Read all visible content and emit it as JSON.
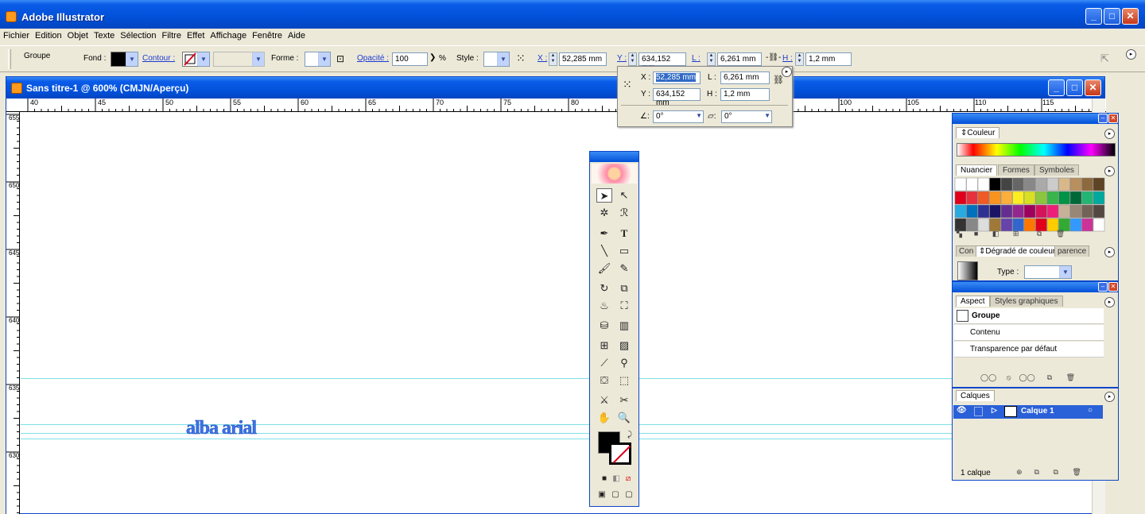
{
  "app": {
    "title": "Adobe Illustrator"
  },
  "menu": [
    "Fichier",
    "Edition",
    "Objet",
    "Texte",
    "Sélection",
    "Filtre",
    "Effet",
    "Affichage",
    "Fenêtre",
    "Aide"
  ],
  "control": {
    "selection": "Groupe",
    "fill_label": "Fond :",
    "stroke_label": "Contour :",
    "shape_label": "Forme :",
    "opacity_label": "Opacité :",
    "opacity_value": "100",
    "opacity_unit": "%",
    "style_label": "Style :",
    "x_label": "X :",
    "x_value": "52,285 mm",
    "y_label": "Y :",
    "y_value": "634,152 mm",
    "l_label": "L :",
    "l_value": "6,261 mm",
    "h_label": "H :",
    "h_value": "1,2 mm"
  },
  "document": {
    "title": "Sans titre-1 @ 600% (CMJN/Aperçu)",
    "hruler_labels": [
      "40",
      "45",
      "50",
      "55",
      "60",
      "65",
      "70",
      "75",
      "80",
      "100",
      "105",
      "110",
      "115"
    ],
    "vruler_labels": [
      "655",
      "650",
      "645",
      "640",
      "635",
      "630"
    ],
    "canvas_text": "alba arial"
  },
  "popup": {
    "x_label": "X :",
    "x_value": "52,285 mm",
    "y_label": "Y :",
    "y_value": "634,152 mm",
    "l_label": "L :",
    "l_value": "6,261 mm",
    "h_label": "H :",
    "h_value": "1,2 mm",
    "angle1": "0°",
    "angle2": "0°"
  },
  "panels": {
    "couleur": {
      "tab": "Couleur"
    },
    "swatches": {
      "tabs": [
        "Nuancier",
        "Formes",
        "Symboles"
      ]
    },
    "gradient": {
      "tabs": [
        "Con",
        "Dégradé de couleurs",
        "parence"
      ],
      "type_label": "Type :"
    },
    "aspect": {
      "tabs": [
        "Aspect",
        "Styles graphiques"
      ],
      "rows": [
        "Groupe",
        "Contenu",
        "Transparence par défaut"
      ]
    },
    "layers": {
      "tab": "Calques",
      "layer_name": "Calque 1",
      "footer": "1 calque"
    }
  },
  "colors": {
    "titlebar": "#0250d8",
    "guide": "#7fdfe8",
    "text_fill": "#3a74e8",
    "selected_layer": "#2a60d8"
  }
}
